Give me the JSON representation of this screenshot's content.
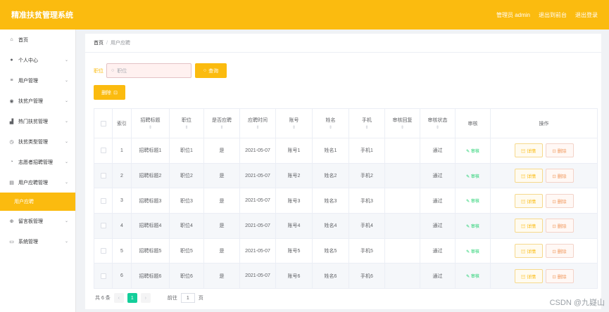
{
  "header": {
    "title": "精准扶贫管理系统",
    "links": [
      "管理员 admin",
      "退出到前台",
      "退出登录"
    ]
  },
  "sidebar": {
    "items": [
      {
        "label": "首页",
        "icon": "home-icon",
        "glyph": "⌂",
        "chevron": false
      },
      {
        "label": "个人中心",
        "icon": "user-icon",
        "glyph": "●",
        "chevron": true
      },
      {
        "label": "用户管理",
        "icon": "list-icon",
        "glyph": "≡",
        "chevron": true
      },
      {
        "label": "扶贫户管理",
        "icon": "location-icon",
        "glyph": "◉",
        "chevron": true
      },
      {
        "label": "热门扶贫管理",
        "icon": "chart-icon",
        "glyph": "▟",
        "chevron": true
      },
      {
        "label": "扶贫类型管理",
        "icon": "clock-icon",
        "glyph": "◷",
        "chevron": true
      },
      {
        "label": "志愿者招聘管理",
        "icon": "timer-icon",
        "glyph": "◔",
        "chevron": true
      },
      {
        "label": "用户应聘管理",
        "icon": "document-icon",
        "glyph": "▤",
        "chevron": true
      }
    ],
    "submenu": "用户应聘",
    "bottom_items": [
      {
        "label": "留言板管理",
        "icon": "globe-icon",
        "glyph": "⊕",
        "chevron": true
      },
      {
        "label": "系统管理",
        "icon": "chat-icon",
        "glyph": "▭",
        "chevron": true
      }
    ]
  },
  "breadcrumb": {
    "home": "首页",
    "separator": "/",
    "current": "用户应聘"
  },
  "search": {
    "label": "职位",
    "placeholder": "职位",
    "button": "查询"
  },
  "delete_button": "删除",
  "table": {
    "headers": [
      "索引",
      "招聘标题",
      "职位",
      "是否应聘",
      "应聘时间",
      "账号",
      "姓名",
      "手机",
      "审核回复",
      "审核状态",
      "审核",
      "操作"
    ],
    "rows": [
      {
        "index": "1",
        "title": "招聘标题1",
        "position": "职位1",
        "applied": "是",
        "time": "2021-05-07",
        "account": "账号1",
        "name": "姓名1",
        "phone": "手机1",
        "reply": "",
        "status": "通过",
        "audit": "审核"
      },
      {
        "index": "2",
        "title": "招聘标题2",
        "position": "职位2",
        "applied": "是",
        "time": "2021-05-07",
        "account": "账号2",
        "name": "姓名2",
        "phone": "手机2",
        "reply": "",
        "status": "通过",
        "audit": "审核"
      },
      {
        "index": "3",
        "title": "招聘标题3",
        "position": "职位3",
        "applied": "是",
        "time": "2021-05-07",
        "account": "账号3",
        "name": "姓名3",
        "phone": "手机3",
        "reply": "",
        "status": "通过",
        "audit": "审核"
      },
      {
        "index": "4",
        "title": "招聘标题4",
        "position": "职位4",
        "applied": "是",
        "time": "2021-05-07",
        "account": "账号4",
        "name": "姓名4",
        "phone": "手机4",
        "reply": "",
        "status": "通过",
        "audit": "审核"
      },
      {
        "index": "5",
        "title": "招聘标题5",
        "position": "职位5",
        "applied": "是",
        "time": "2021-05-07",
        "account": "账号5",
        "name": "姓名5",
        "phone": "手机5",
        "reply": "",
        "status": "通过",
        "audit": "审核"
      },
      {
        "index": "6",
        "title": "招聘标题6",
        "position": "职位6",
        "applied": "是",
        "time": "2021-05-07",
        "account": "账号6",
        "name": "姓名6",
        "phone": "手机6",
        "reply": "",
        "status": "通过",
        "audit": "审核"
      }
    ],
    "detail_label": "详情",
    "delete_label": "删除"
  },
  "pagination": {
    "total": "共 6 条",
    "current_page": "1",
    "goto_label": "前往",
    "goto_value": "1",
    "page_suffix": "页"
  },
  "watermark": "CSDN @九嶷山",
  "colors": {
    "accent": "#fbbb0f",
    "page_active": "#13ce9a",
    "audit": "#13ce66"
  }
}
